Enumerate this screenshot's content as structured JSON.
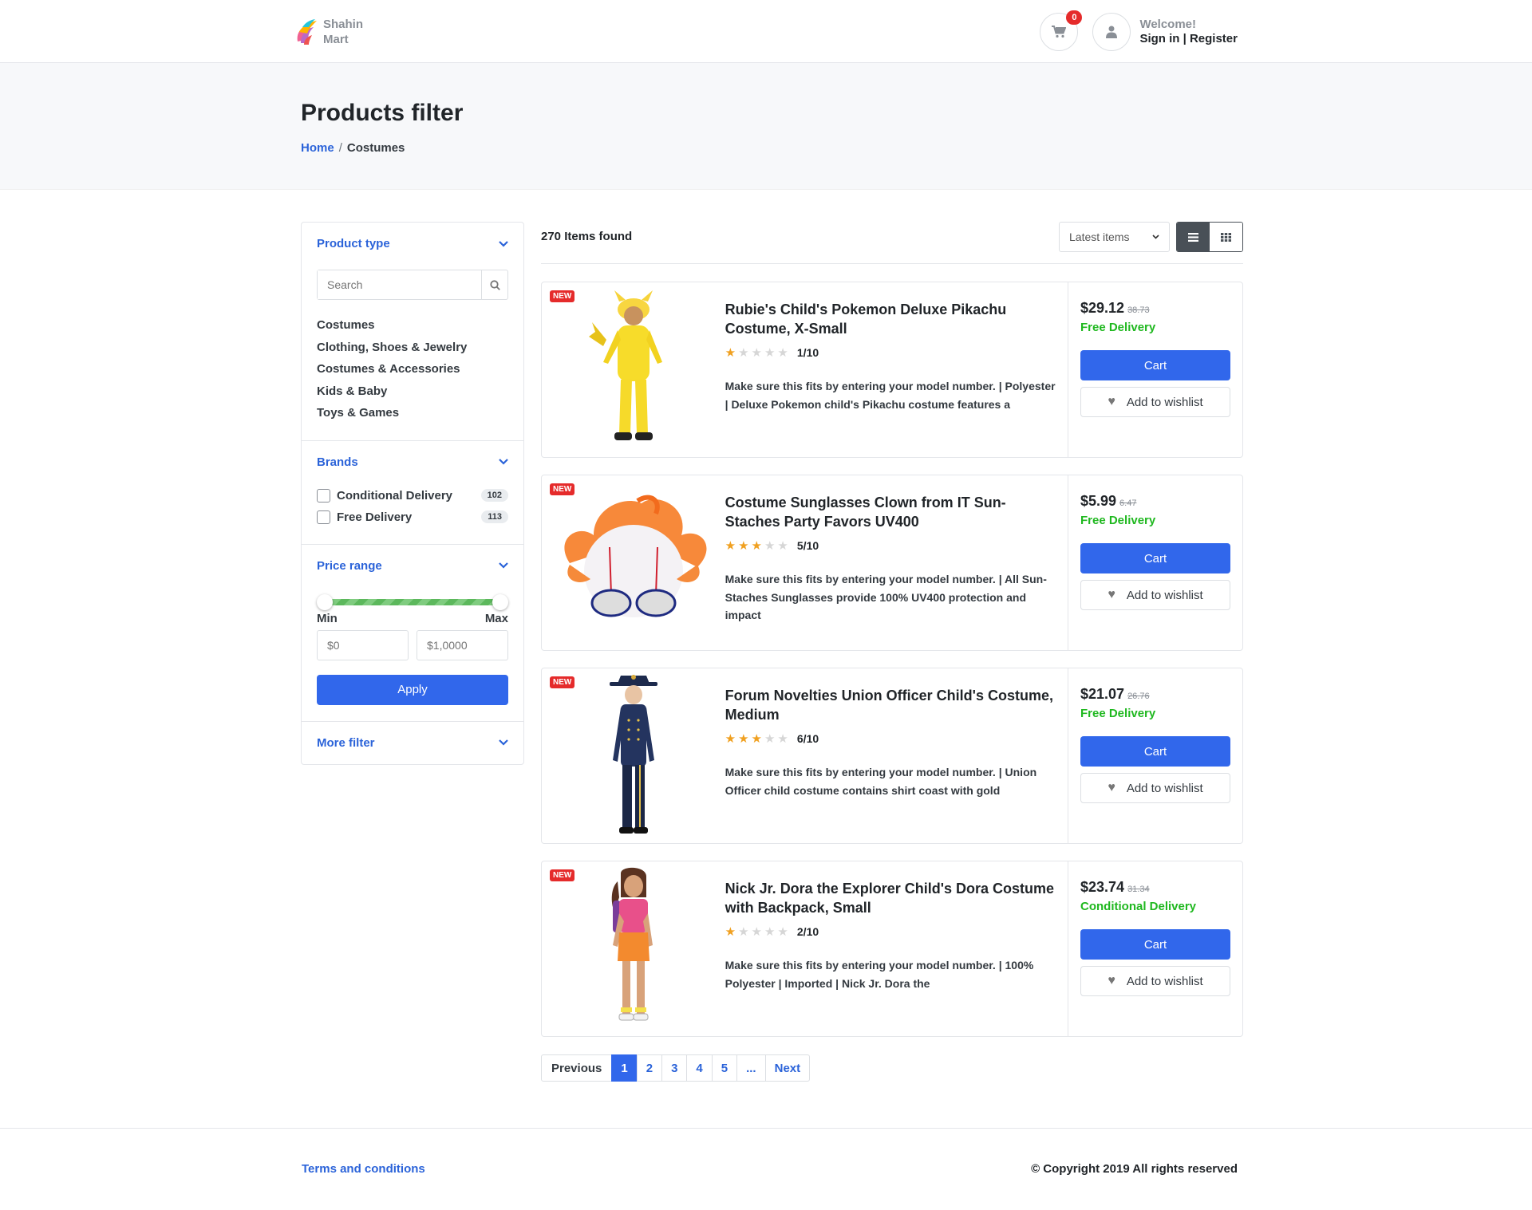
{
  "header": {
    "brand_line1": "Shahin",
    "brand_line2": "Mart",
    "cart_count": "0",
    "welcome": "Welcome!",
    "auth_links": "Sign in | Register"
  },
  "page": {
    "title": "Products filter",
    "breadcrumb": {
      "home": "Home",
      "separator": "/",
      "current": "Costumes"
    }
  },
  "filters": {
    "product_type": {
      "title": "Product type",
      "search_placeholder": "Search",
      "categories": [
        "Costumes",
        "Clothing, Shoes & Jewelry",
        "Costumes & Accessories",
        "Kids & Baby",
        "Toys & Games"
      ]
    },
    "brands": {
      "title": "Brands",
      "items": [
        {
          "label": "Conditional Delivery",
          "count": "102"
        },
        {
          "label": "Free Delivery",
          "count": "113"
        }
      ]
    },
    "price_range": {
      "title": "Price range",
      "min_label": "Min",
      "max_label": "Max",
      "min_placeholder": "$0",
      "max_placeholder": "$1,0000",
      "apply_label": "Apply"
    },
    "more": {
      "title": "More filter"
    }
  },
  "toolbar": {
    "items_found": "270 Items found",
    "sort_selected": "Latest items"
  },
  "products": [
    {
      "badge": "NEW",
      "title": "Rubie's Child's Pokemon Deluxe Pikachu Costume, X-Small",
      "rating_text": "1/10",
      "stars_on": 1,
      "desc": "Make sure this fits by entering your model number. | Polyester | Deluxe Pokemon child's Pikachu costume features a",
      "price": "$29.12",
      "old_price": "38.73",
      "delivery": "Free Delivery",
      "cart_label": "Cart",
      "wishlist_label": "Add to wishlist"
    },
    {
      "badge": "NEW",
      "title": "Costume Sunglasses Clown from IT Sun-Staches Party Favors UV400",
      "rating_text": "5/10",
      "stars_on": 3,
      "desc": "Make sure this fits by entering your model number. | All Sun-Staches Sunglasses provide 100% UV400 protection and impact",
      "price": "$5.99",
      "old_price": "6.47",
      "delivery": "Free Delivery",
      "cart_label": "Cart",
      "wishlist_label": "Add to wishlist"
    },
    {
      "badge": "NEW",
      "title": "Forum Novelties Union Officer Child's Costume, Medium",
      "rating_text": "6/10",
      "stars_on": 3,
      "desc": "Make sure this fits by entering your model number. | Union Officer child costume contains shirt coast with gold",
      "price": "$21.07",
      "old_price": "26.76",
      "delivery": "Free Delivery",
      "cart_label": "Cart",
      "wishlist_label": "Add to wishlist"
    },
    {
      "badge": "NEW",
      "title": "Nick Jr. Dora the Explorer Child's Dora Costume with Backpack, Small",
      "rating_text": "2/10",
      "stars_on": 1,
      "desc": "Make sure this fits by entering your model number. | 100% Polyester | Imported | Nick Jr. Dora the",
      "price": "$23.74",
      "old_price": "31.34",
      "delivery": "Conditional Delivery",
      "cart_label": "Cart",
      "wishlist_label": "Add to wishlist"
    }
  ],
  "pagination": {
    "prev": "Previous",
    "pages": [
      "1",
      "2",
      "3",
      "4",
      "5",
      "..."
    ],
    "next": "Next"
  },
  "footer": {
    "terms": "Terms and conditions",
    "copyright": "© Copyright 2019 All rights reserved"
  }
}
